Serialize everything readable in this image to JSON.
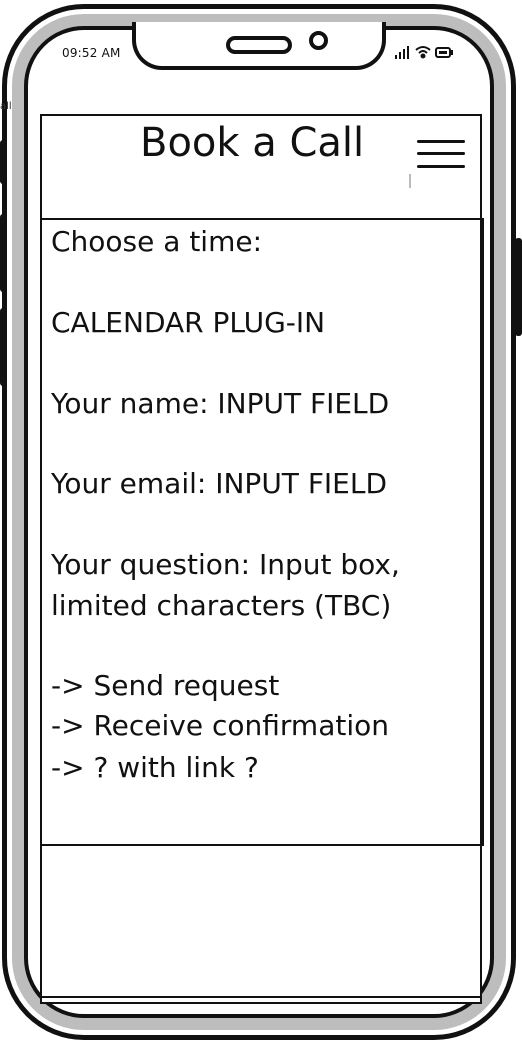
{
  "status_bar": {
    "time": "09:52 AM",
    "icons": [
      "signal-icon",
      "wifi-icon",
      "battery-icon"
    ]
  },
  "edge_label": "all",
  "header": {
    "title": "Book a Call",
    "menu_icon": "hamburger-menu-icon"
  },
  "content": {
    "choose_time": "Choose a time:",
    "calendar": "CALENDAR PLUG-IN",
    "name": "Your name: INPUT FIELD",
    "email": "Your email: INPUT FIELD",
    "question_line1": "Your question: Input box,",
    "question_line2": "limited characters (TBC)",
    "step1": "-> Send request",
    "step2": "-> Receive confirmation",
    "step3": "-> ? with link ?"
  }
}
